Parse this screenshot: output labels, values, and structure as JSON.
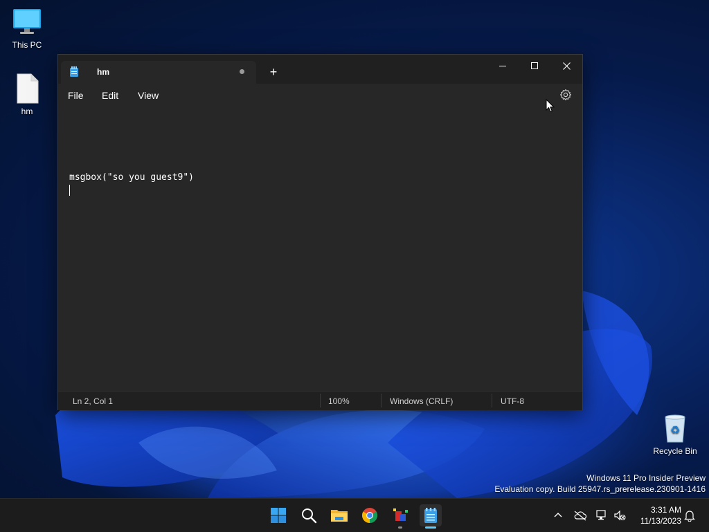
{
  "desktop": {
    "icons": [
      {
        "label": "This PC"
      },
      {
        "label": "hm"
      },
      {
        "label": "Recycle Bin"
      }
    ],
    "watermark": {
      "line1": "Windows 11 Pro Insider Preview",
      "line2": "Evaluation copy. Build 25947.rs_prerelease.230901-1416"
    }
  },
  "notepad": {
    "tab_title": "hm",
    "new_tab_symbol": "+",
    "menu": {
      "file": "File",
      "edit": "Edit",
      "view": "View"
    },
    "editor_lines": [
      "msgbox(\"so you guest9\")",
      ""
    ],
    "status": {
      "position": "Ln 2, Col 1",
      "zoom": "100%",
      "line_ending": "Windows (CRLF)",
      "encoding": "UTF-8"
    }
  },
  "taskbar": {
    "apps": [
      "start-icon",
      "search-icon",
      "file-explorer-icon",
      "chrome-icon",
      "paint-icon",
      "notepad-icon"
    ],
    "clock": {
      "time": "3:31 AM",
      "date": "11/13/2023"
    }
  },
  "colors": {
    "accent": "#60cdff",
    "window_bg": "#272727",
    "titlebar_bg": "#202020",
    "taskbar_bg": "#1c1c1c"
  }
}
